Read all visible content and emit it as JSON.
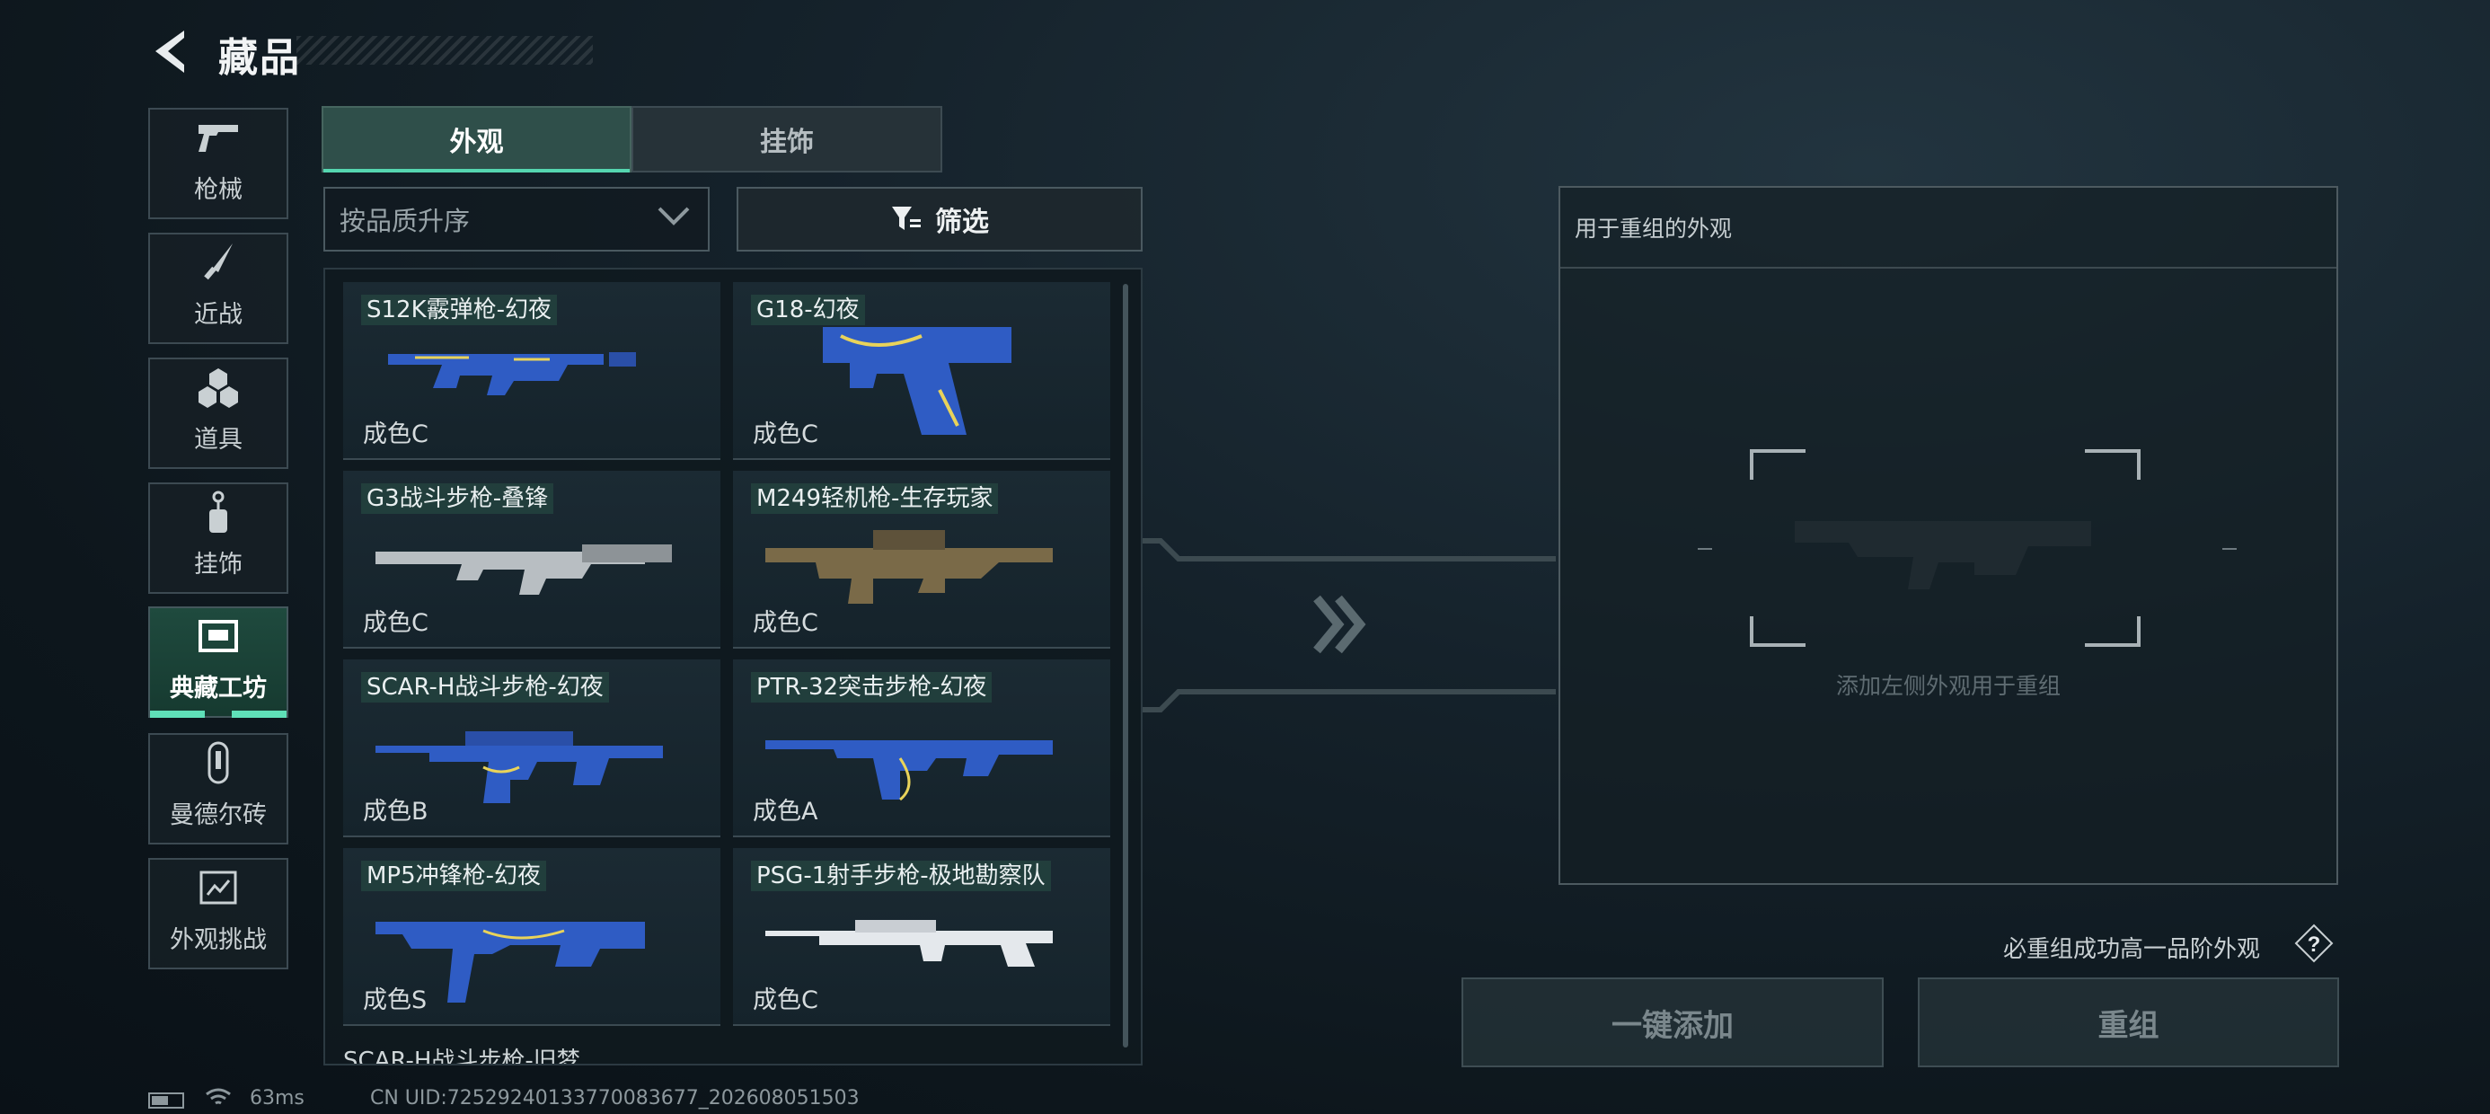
{
  "header": {
    "title": "藏品",
    "back_icon": "chevron-left-icon"
  },
  "sidebar": {
    "items": [
      {
        "label": "枪械",
        "icon": "pistol-icon",
        "active": false
      },
      {
        "label": "近战",
        "icon": "knife-icon",
        "active": false
      },
      {
        "label": "道具",
        "icon": "cubes-icon",
        "active": false
      },
      {
        "label": "挂饰",
        "icon": "charm-icon",
        "active": false
      },
      {
        "label": "典藏工坊",
        "icon": "workshop-icon",
        "active": true
      },
      {
        "label": "曼德尔砖",
        "icon": "mandel-brick-icon",
        "active": false
      },
      {
        "label": "外观挑战",
        "icon": "challenge-icon",
        "active": false
      }
    ]
  },
  "tabs": [
    {
      "label": "外观",
      "selected": true
    },
    {
      "label": "挂饰",
      "selected": false
    }
  ],
  "sort": {
    "value": "按品质升序"
  },
  "filter": {
    "label": "筛选"
  },
  "grid": {
    "items": [
      {
        "name": "S12K霰弹枪-幻夜",
        "grade": "成色C",
        "skin": "starry"
      },
      {
        "name": "G18-幻夜",
        "grade": "成色C",
        "skin": "starry"
      },
      {
        "name": "G3战斗步枪-叠锋",
        "grade": "成色C",
        "skin": "silver"
      },
      {
        "name": "M249轻机枪-生存玩家",
        "grade": "成色C",
        "skin": "camo"
      },
      {
        "name": "SCAR-H战斗步枪-幻夜",
        "grade": "成色B",
        "skin": "starry"
      },
      {
        "name": "PTR-32突击步枪-幻夜",
        "grade": "成色A",
        "skin": "starry"
      },
      {
        "name": "MP5冲锋枪-幻夜",
        "grade": "成色S",
        "skin": "starry"
      },
      {
        "name": "PSG-1射手步枪-极地勘察队",
        "grade": "成色C",
        "skin": "arctic"
      }
    ],
    "partial_next": "SCAR-H战斗步枪-旧梦"
  },
  "recombine": {
    "panel_title": "用于重组的外观",
    "slot_hint": "添加左侧外观用于重组",
    "note": "必重组成功高一品阶外观",
    "help_icon": "question-icon",
    "add_all_label": "一键添加",
    "recombine_label": "重组"
  },
  "status_bar": {
    "latency": "63ms",
    "uid": "CN UID:72529240133770083677_202608051503"
  },
  "colors": {
    "accent": "#55d6b0",
    "active_tab": "#2f4f4a",
    "starry": "#2f5cc4",
    "camo": "#7a6a48",
    "silver": "#b8bec2",
    "arctic": "#e4e8ec"
  }
}
